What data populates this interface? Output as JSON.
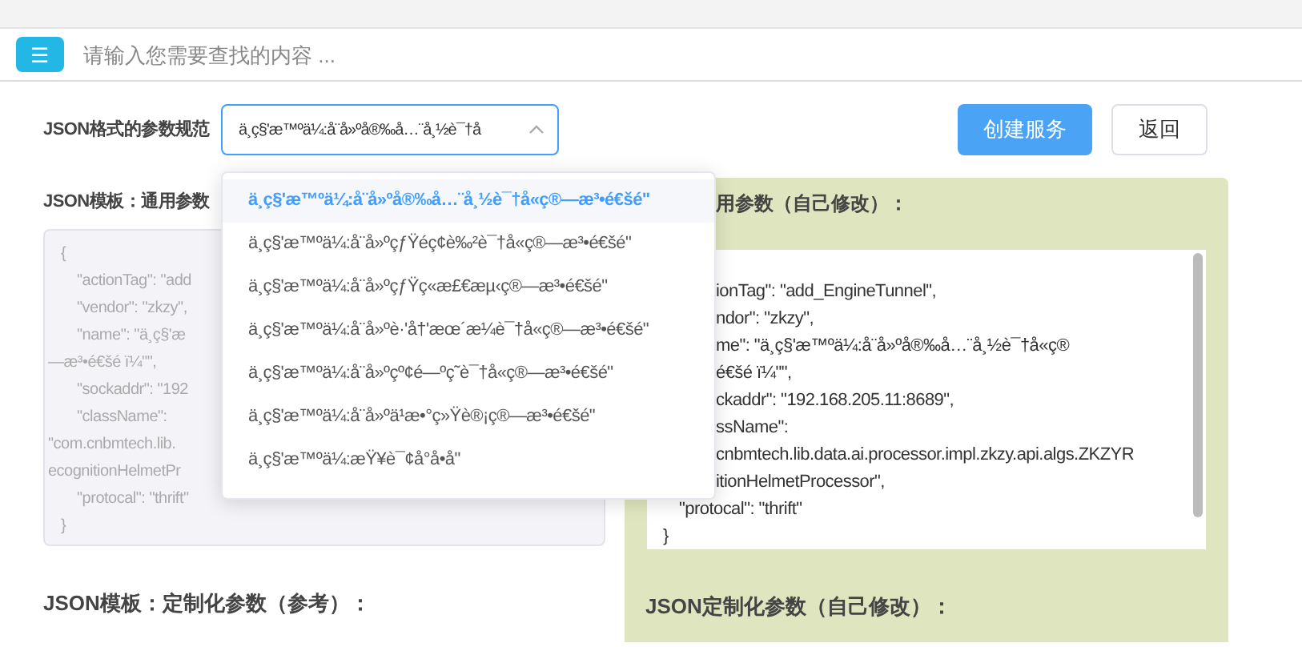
{
  "header": {
    "menu_button": "☰",
    "search": {
      "placeholder": "请输入您需要查找的内容 ..."
    }
  },
  "form": {
    "label": "JSON格式的参数规范",
    "select": {
      "value": "ä¸ç§'æ™ºä¼:å¨å»ºå®‰å…¨å¸½è¯†å",
      "expanded": true
    },
    "buttons": [
      {
        "label": "创建服务",
        "kind": "primary"
      },
      {
        "label": "返回",
        "kind": "default"
      }
    ]
  },
  "dropdown": {
    "options": [
      {
        "label": "ä¸ç§'æ™ºä¼:å¨å»ºå®‰å…¨å¸½è¯†å«ç®—æ³•é€šé\"",
        "selected": true
      },
      {
        "label": "ä¸ç§'æ™ºä¼:å¨å»ºçƒŸéç¢è‰²è¯†å«ç®—æ³•é€šé\"",
        "selected": false
      },
      {
        "label": "ä¸ç§'æ™ºä¼:å¨å»ºçƒŸç«æ£€æµ‹ç®—æ³•é€šé\"",
        "selected": false
      },
      {
        "label": "ä¸ç§'æ™ºä¼:å¨å»ºè·'å†'æœ´æ¼è¯†å«ç®—æ³•é€šé\"",
        "selected": false
      },
      {
        "label": "ä¸ç§'æ™ºä¼:å¨å»ºçº¢é—ºç˜è¯†å«ç®—æ³•é€šé\"",
        "selected": false
      },
      {
        "label": "ä¸ç§'æ™ºä¼:å¨å»ºä¹æ•°ç»Ÿè®¡ç®—æ³•é€šé\"",
        "selected": false
      },
      {
        "label": "ä¸ç§'æ™ºä¼:æŸ¥è¯¢å°å•å\"",
        "selected": false
      }
    ]
  },
  "template_general": {
    "heading": "JSON模板：通用参数",
    "lines": [
      {
        "text": "{",
        "kind": "brace"
      },
      {
        "text": "\"actionTag\": \"add",
        "kind": "key"
      },
      {
        "text": "\"vendor\": \"zkzy\",",
        "kind": "key"
      },
      {
        "text": "\"name\": \"ä¸ç§'æ",
        "kind": "key"
      },
      {
        "text": "—æ³•é€šé ï¼\"\",",
        "kind": "wrap"
      },
      {
        "text": "\"sockaddr\": \"192",
        "kind": "key"
      },
      {
        "text": "\"className\":",
        "kind": "key"
      },
      {
        "text": "\"com.cnbmtech.lib.",
        "kind": "wrap"
      },
      {
        "text": "ecognitionHelmetPr",
        "kind": "wrap"
      },
      {
        "text": "\"protocal\": \"thrift\"",
        "kind": "key"
      },
      {
        "text": "}",
        "kind": "brace"
      }
    ]
  },
  "custom_general": {
    "heading": "用参数（自己修改）：",
    "lines": [
      {
        "text": "ionTag\": \"add_EngineTunnel\",",
        "kind": "cut"
      },
      {
        "text": "ndor\": \"zkzy\",",
        "kind": "cut"
      },
      {
        "text": "me\": \"ä¸ç§'æ™ºä¼:å¨å»ºå®‰å…¨å¸½è¯†å«ç®",
        "kind": "cut"
      },
      {
        "text": "é€šé ï¼\"\",",
        "kind": "cut"
      },
      {
        "text": "ckaddr\": \"192.168.205.11:8689\",",
        "kind": "cut"
      },
      {
        "text": "ssName\":",
        "kind": "cut"
      },
      {
        "text": "cnbmtech.lib.data.ai.processor.impl.zkzy.api.algs.ZKZYR",
        "kind": "cut"
      },
      {
        "text": "itionHelmetProcessor\",",
        "kind": "cut"
      },
      {
        "text": "\"protocal\": \"thrift\"",
        "kind": "key"
      },
      {
        "text": "}",
        "kind": "brace"
      }
    ]
  },
  "template_custom": {
    "heading": "JSON模板：定制化参数（参考）："
  },
  "custom_custom": {
    "heading": "JSON定制化参数（自己修改）："
  }
}
